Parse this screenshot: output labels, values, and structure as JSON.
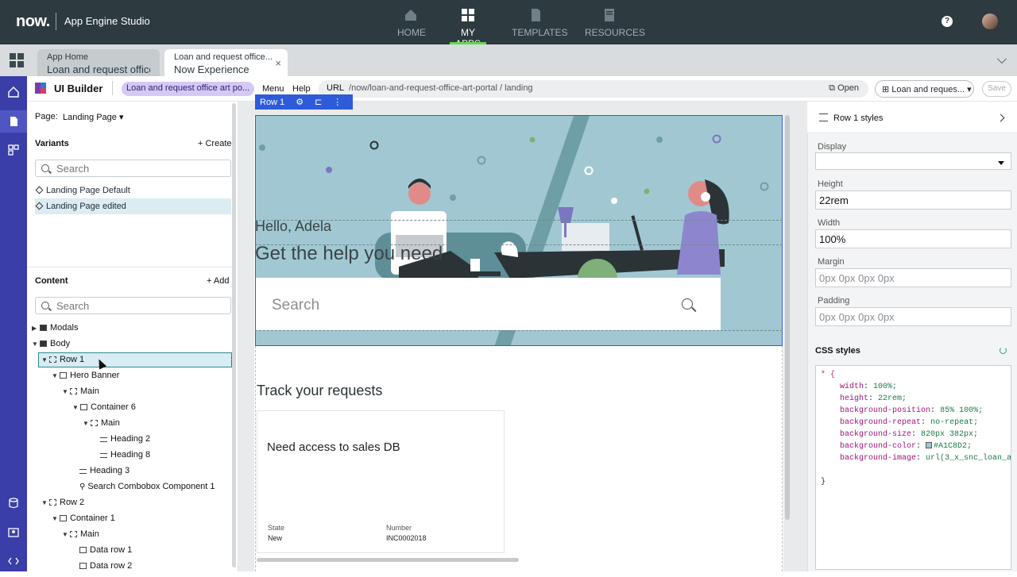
{
  "topbar": {
    "logo": "now.",
    "app_name": "App Engine Studio",
    "nav": [
      {
        "label": "HOME",
        "icon": "home-icon"
      },
      {
        "label": "MY APPS",
        "icon": "grid-icon",
        "active": true
      },
      {
        "label": "TEMPLATES",
        "icon": "document-icon"
      },
      {
        "label": "RESOURCES",
        "icon": "book-icon"
      }
    ],
    "help_label": "?"
  },
  "tabs": [
    {
      "title": "App Home",
      "subtitle": "Loan and request office..."
    },
    {
      "title": "Loan and request office...",
      "subtitle": "Now Experience",
      "close": "×"
    }
  ],
  "toolbar": {
    "title": "UI Builder",
    "app_pill": "Loan and request office art po...",
    "menu": "Menu",
    "help": "Help",
    "url_label": "URL",
    "url": "/now/loan-and-request-office-art-portal / landing",
    "open": "Open",
    "variant_select": "Loan and reques...",
    "save": "Save"
  },
  "left_panel": {
    "page_label": "Page:",
    "page_value": "Landing Page",
    "variants_title": "Variants",
    "create": "+ Create",
    "variants_search_placeholder": "Search",
    "variants": [
      "Landing Page Default",
      "Landing Page edited"
    ],
    "content_title": "Content",
    "add": "+ Add",
    "content_search_placeholder": "Search",
    "tree": [
      {
        "label": "Modals",
        "depth": 0
      },
      {
        "label": "Body",
        "depth": 0
      },
      {
        "label": "Row 1",
        "depth": 1
      },
      {
        "label": "Hero Banner",
        "depth": 2
      },
      {
        "label": "Main",
        "depth": 3
      },
      {
        "label": "Container 6",
        "depth": 4
      },
      {
        "label": "Main",
        "depth": 5
      },
      {
        "label": "Heading 2",
        "depth": 6
      },
      {
        "label": "Heading 8",
        "depth": 6
      },
      {
        "label": "Heading 3",
        "depth": 4
      },
      {
        "label": "Search Combobox Component 1",
        "depth": 4
      },
      {
        "label": "Row 2",
        "depth": 1
      },
      {
        "label": "Container 1",
        "depth": 2
      },
      {
        "label": "Main",
        "depth": 3
      },
      {
        "label": "Data row 1",
        "depth": 4
      },
      {
        "label": "Data row 2",
        "depth": 4
      }
    ]
  },
  "canvas": {
    "row_tag": "Row 1",
    "greeting": "Hello, Adela",
    "headline": "Get the help you need",
    "search_placeholder": "Search",
    "track_title": "Track your requests",
    "card": {
      "title": "Need access to sales DB",
      "state_label": "State",
      "state_value": "New",
      "number_label": "Number",
      "number_value": "INC0002018"
    }
  },
  "right_panel": {
    "title": "Row 1 styles",
    "display_label": "Display",
    "display_value": "",
    "height_label": "Height",
    "height_value": "22rem",
    "width_label": "Width",
    "width_value": "100%",
    "margin_label": "Margin",
    "margin_placeholder": "0px 0px 0px 0px",
    "padding_label": "Padding",
    "padding_placeholder": "0px 0px 0px 0px",
    "css_label": "CSS styles",
    "css": {
      "selector": "* {",
      "rules": [
        {
          "k": "width",
          "v": "100%;"
        },
        {
          "k": "height",
          "v": "22rem;"
        },
        {
          "k": "background-position",
          "v": "85% 100%;"
        },
        {
          "k": "background-repeat",
          "v": "no-repeat;"
        },
        {
          "k": "background-size",
          "v": "820px 382px;"
        },
        {
          "k": "background-color",
          "v": "#A1C8D2;"
        },
        {
          "k": "background-image",
          "v": "url(3_x_snc_loan_a"
        }
      ],
      "close": "}"
    }
  },
  "colors": {
    "topbar": "#2d3a3f",
    "rail": "#3a3ea8",
    "hero": "#A1C8D2",
    "accent_green": "#62d84e",
    "selection_blue": "#2e5bd8"
  }
}
